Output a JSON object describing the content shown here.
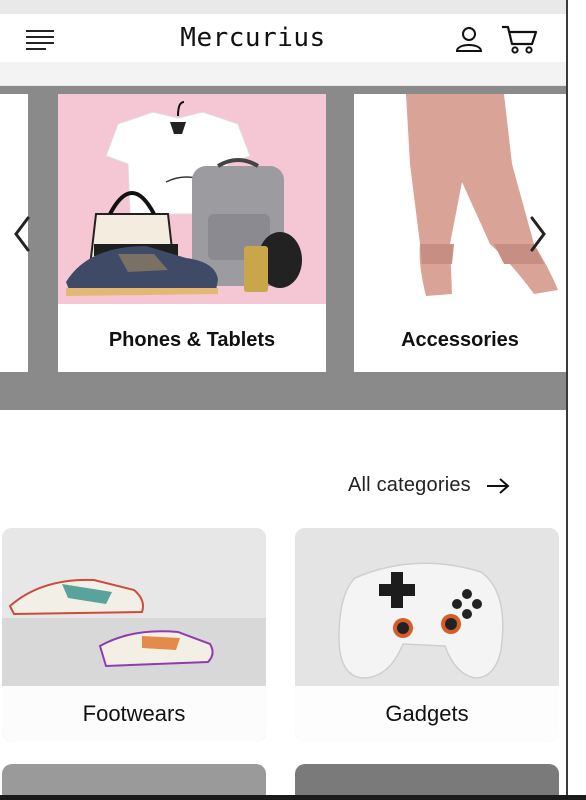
{
  "header": {
    "brand": "Mercurius",
    "menu_icon": "hamburger-menu-icon",
    "account_icon": "user-icon",
    "cart_icon": "shopping-cart-icon"
  },
  "carousel": {
    "background_color": "#8a8a8a",
    "cards": [
      {
        "label": "Phones & Tablets",
        "image_bg": "#f5c6d4"
      },
      {
        "label": "Accessories",
        "image_bg": "#ffffff"
      }
    ],
    "prev_icon": "chevron-left-icon",
    "next_icon": "chevron-right-icon"
  },
  "categories": {
    "link_label": "All categories",
    "link_icon": "arrow-right-icon",
    "tiles": [
      {
        "label": "Footwears"
      },
      {
        "label": "Gadgets"
      }
    ]
  }
}
